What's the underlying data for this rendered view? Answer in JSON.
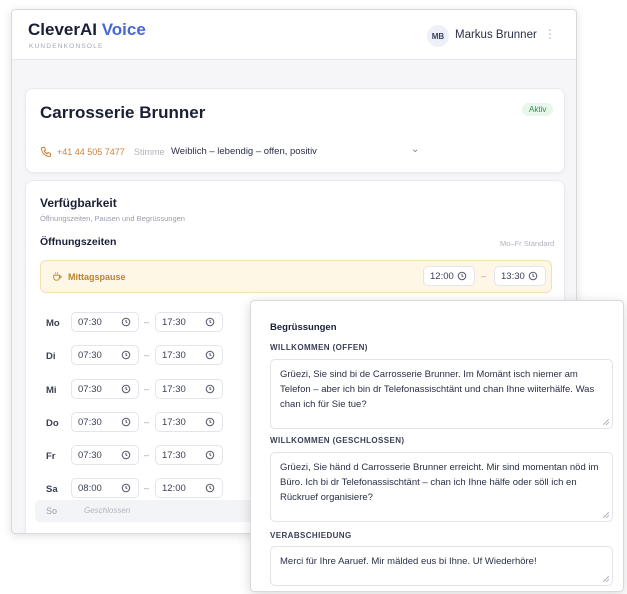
{
  "app": {
    "brand_main": "CleverAI",
    "brand_accent": "Voice",
    "subtitle": "KUNDENKONSOLE",
    "user_initials": "MB",
    "user_name": "Markus Brunner"
  },
  "company": {
    "name": "Carrosserie Brunner",
    "status": "Aktiv",
    "phone": "+41 44 505 7477",
    "voice_label": "Stimme",
    "voice_value": "Weiblich – lebendig – offen, positiv"
  },
  "availability": {
    "title": "Verfügbarkeit",
    "subtitle": "Öffnungszeiten, Pausen und Begrüssungen",
    "hours_title": "Öffnungszeiten",
    "hours_std": "Mo–Fr Standard",
    "pause": {
      "label": "Mittagspause",
      "from": "12:00",
      "to": "13:30"
    },
    "days": [
      {
        "day": "Mo",
        "from": "07:30",
        "to": "17:30"
      },
      {
        "day": "Di",
        "from": "07:30",
        "to": "17:30"
      },
      {
        "day": "Mi",
        "from": "07:30",
        "to": "17:30"
      },
      {
        "day": "Do",
        "from": "07:30",
        "to": "17:30"
      },
      {
        "day": "Fr",
        "from": "07:30",
        "to": "17:30"
      },
      {
        "day": "Sa",
        "from": "08:00",
        "to": "12:00"
      }
    ],
    "closed_day": {
      "day": "So",
      "text": "Geschlossen"
    }
  },
  "greetings": {
    "title": "Begrüssungen",
    "open_label": "WILLKOMMEN (OFFEN)",
    "open_text": "Grüezi, Sie sind bi de Carrosserie Brunner. Im Momänt isch niemer am Telefon – aber ich bin dr Telefonassischtänt und chan Ihne wiiterhälfe. Was chan ich für Sie tue?",
    "closed_label": "WILLKOMMEN (GESCHLOSSEN)",
    "closed_text": "Grüezi, Sie händ d Carrosserie Brunner erreicht. Mir sind momentan nöd im Büro. Ich bi dr Telefonassischtänt – chan ich Ihne hälfe oder söll ich en Rückruef organisiere?",
    "bye_label": "VERABSCHIEDUNG",
    "bye_text": "Merci für Ihre Aaruef. Mir mälded eus bi Ihne. Uf Wiederhöre!"
  }
}
